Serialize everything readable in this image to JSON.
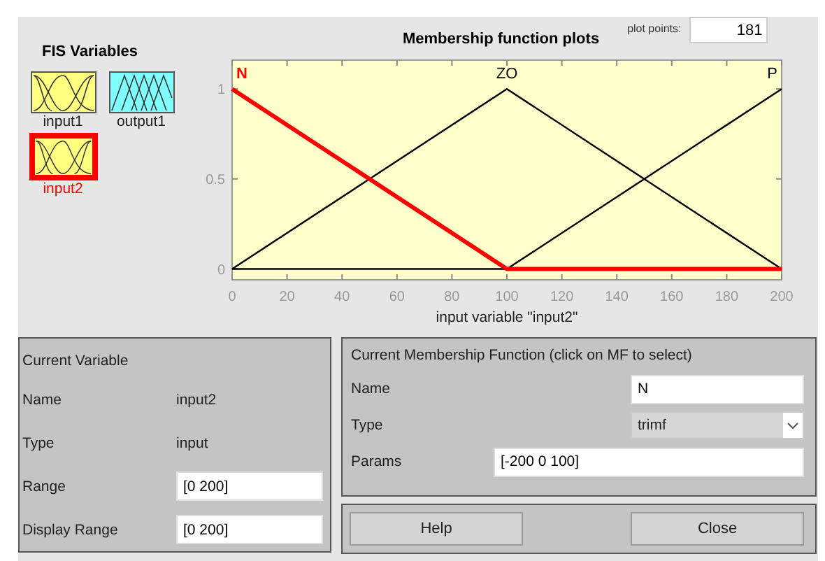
{
  "variables_panel": {
    "title": "FIS Variables",
    "variables": [
      {
        "name": "input1",
        "kind": "input",
        "selected": false
      },
      {
        "name": "output1",
        "kind": "output",
        "selected": false
      },
      {
        "name": "input2",
        "kind": "input",
        "selected": true
      }
    ]
  },
  "plot": {
    "membership_functions": [
      {
        "selected": true
      },
      {
        "selected": false
      },
      {
        "selected": false
      }
    ],
    "plot_points_label": "plot points:",
    "plot_points": "181",
    "chart_data": {
      "type": "line",
      "title": "Membership function plots",
      "xlabel": "input variable \"input2\"",
      "x": [
        0,
        100,
        200
      ],
      "xlim": [
        0,
        200
      ],
      "ylim": [
        -0.06,
        1.16
      ],
      "xticks": [
        0,
        20,
        40,
        60,
        80,
        100,
        120,
        140,
        160,
        180,
        200
      ],
      "yticks": [
        0,
        0.5,
        1
      ],
      "series": [
        {
          "name": "N",
          "color": "#ff0000",
          "values": [
            1,
            0,
            0
          ]
        },
        {
          "name": "ZO",
          "color": "#000000",
          "values": [
            0,
            1,
            0
          ]
        },
        {
          "name": "P",
          "color": "#000000",
          "values": [
            0,
            0,
            1
          ]
        }
      ]
    }
  },
  "current_variable": {
    "title": "Current Variable",
    "fields": [
      {
        "label": "Name",
        "value": "input2",
        "kind": "text"
      },
      {
        "label": "Type",
        "value": "input",
        "kind": "text"
      },
      {
        "label": "Range",
        "value": "[0 200]",
        "kind": "input"
      },
      {
        "label": "Display Range",
        "value": "[0 200]",
        "kind": "input"
      }
    ]
  },
  "current_mf": {
    "title": "Current Membership Function (click on MF to select)",
    "fields": [
      {
        "label": "Name",
        "value": "N",
        "kind": "input"
      },
      {
        "label": "Type",
        "value": "trimf",
        "kind": "select"
      },
      {
        "label": "Params",
        "value": "[-200 0 100]",
        "kind": "wide_input"
      }
    ]
  },
  "buttons": [
    "Help",
    "Close"
  ]
}
